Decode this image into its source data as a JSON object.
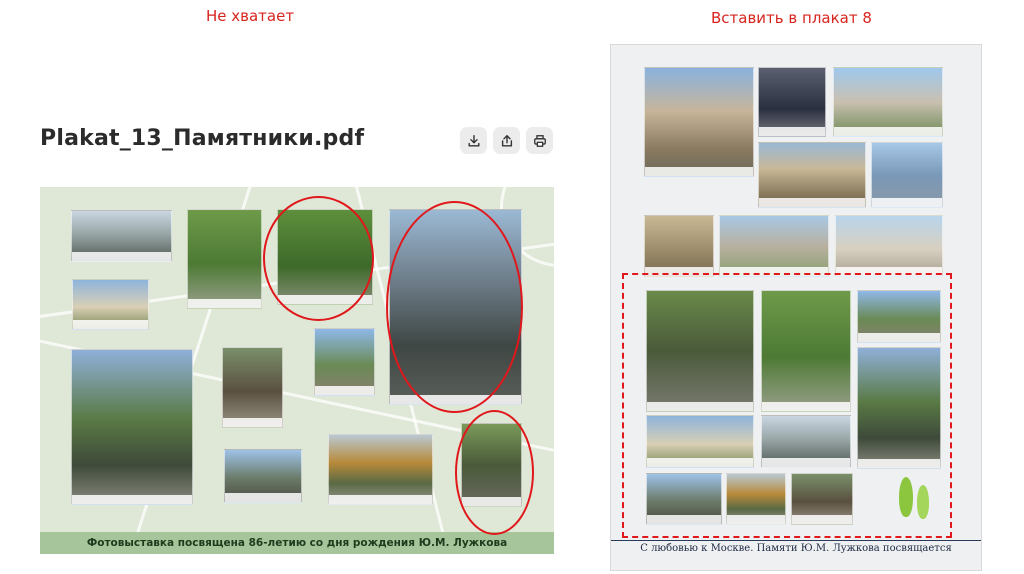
{
  "notes": {
    "left": "Не хватает",
    "right": "Вставить в плакат 8"
  },
  "file": {
    "title": "Plakat_13_Памятники.pdf"
  },
  "toolbar": {
    "download_icon": "download-icon",
    "share_icon": "share-icon",
    "print_icon": "print-icon"
  },
  "poster_left": {
    "footer": "Фотовыставка посвящена 86-летию со дня рождения Ю.М. Лужкова"
  },
  "poster_right": {
    "footer": "С любовью к Москве. Памяти Ю.М. Лужкова посвящается"
  },
  "colors": {
    "annotation": "#e0181b",
    "poster_bg": "#dfe8d7",
    "footer_bar": "#a6c59a"
  }
}
